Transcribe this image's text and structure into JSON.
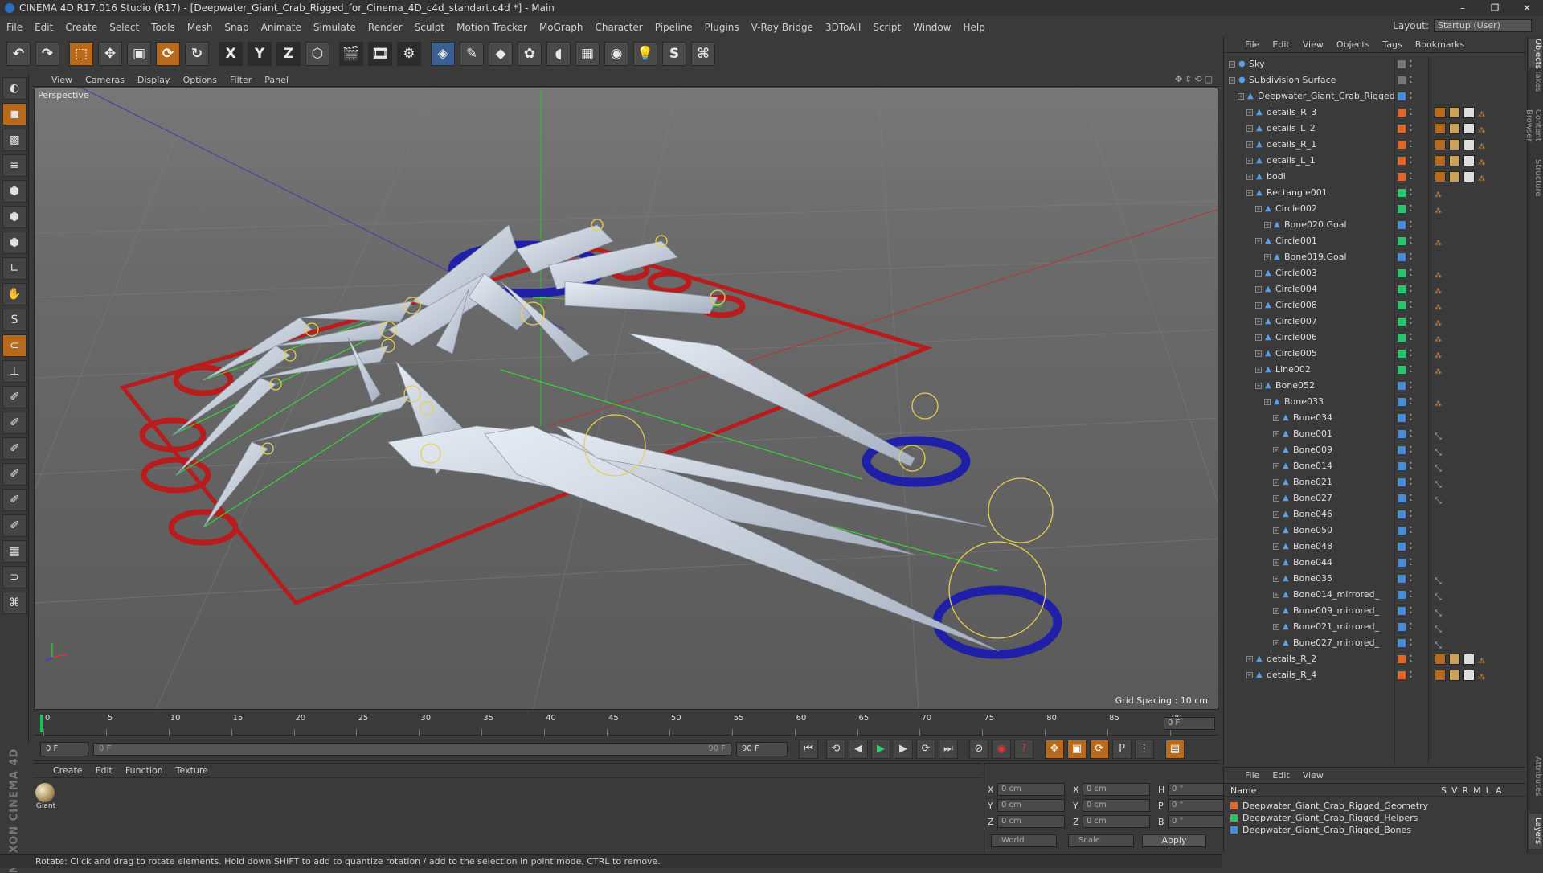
{
  "window": {
    "title": "CINEMA 4D R17.016 Studio (R17) - [Deepwater_Giant_Crab_Rigged_for_Cinema_4D_c4d_standart.c4d *] - Main",
    "controls": [
      "–",
      "❐",
      "✕"
    ]
  },
  "menubar": [
    "File",
    "Edit",
    "Create",
    "Select",
    "Tools",
    "Mesh",
    "Snap",
    "Animate",
    "Simulate",
    "Render",
    "Sculpt",
    "Motion Tracker",
    "MoGraph",
    "Character",
    "Pipeline",
    "Plugins",
    "V-Ray Bridge",
    "3DToAll",
    "Script",
    "Window",
    "Help"
  ],
  "layout": {
    "label": "Layout:",
    "value": "Startup (User)"
  },
  "toolbar": {
    "x": "X",
    "y": "Y",
    "z": "Z"
  },
  "viewport": {
    "menu": [
      "View",
      "Cameras",
      "Display",
      "Options",
      "Filter",
      "Panel"
    ],
    "label": "Perspective",
    "grid_spacing": "Grid Spacing : 10 cm"
  },
  "timeline": {
    "ticks": [
      "0",
      "5",
      "10",
      "15",
      "20",
      "25",
      "30",
      "35",
      "40",
      "45",
      "50",
      "55",
      "60",
      "65",
      "70",
      "75",
      "80",
      "85",
      "90"
    ],
    "current_frame_field": "0 F"
  },
  "transport": {
    "start": "0 F",
    "slider_start": "0 F",
    "slider_end": "90 F",
    "end": "90 F"
  },
  "materials": {
    "menu": [
      "Create",
      "Edit",
      "Function",
      "Texture"
    ],
    "items": [
      {
        "name": "Giant"
      }
    ]
  },
  "coords": {
    "rows": [
      {
        "a": "X",
        "av": "0 cm",
        "b": "X",
        "bv": "0 cm",
        "c": "H",
        "cv": "0 °"
      },
      {
        "a": "Y",
        "av": "0 cm",
        "b": "Y",
        "bv": "0 cm",
        "c": "P",
        "cv": "0 °"
      },
      {
        "a": "Z",
        "av": "0 cm",
        "b": "Z",
        "bv": "0 cm",
        "c": "B",
        "cv": "0 °"
      }
    ],
    "mode": "World",
    "type": "Scale",
    "apply": "Apply"
  },
  "status": "Rotate: Click and drag to rotate elements. Hold down SHIFT to add to quantize rotation / add to the selection in point mode, CTRL to remove.",
  "objects": {
    "menu": [
      "File",
      "Edit",
      "View",
      "Objects",
      "Tags",
      "Bookmarks"
    ],
    "rows": [
      {
        "name": "Sky",
        "color": "#777777"
      },
      {
        "name": "Subdivision Surface",
        "color": "#777777"
      },
      {
        "name": "Deepwater_Giant_Crab_Rigged",
        "color": "#4a8bd6"
      },
      {
        "name": "details_R_3",
        "color": "#e0662a"
      },
      {
        "name": "details_L_2",
        "color": "#e0662a"
      },
      {
        "name": "details_R_1",
        "color": "#e0662a"
      },
      {
        "name": "details_L_1",
        "color": "#e0662a"
      },
      {
        "name": "bodi",
        "color": "#e0662a"
      },
      {
        "name": "Rectangle001",
        "color": "#25c46d"
      },
      {
        "name": "Circle002",
        "color": "#25c46d"
      },
      {
        "name": "Bone020.Goal",
        "color": "#4a8bd6"
      },
      {
        "name": "Circle001",
        "color": "#25c46d"
      },
      {
        "name": "Bone019.Goal",
        "color": "#4a8bd6"
      },
      {
        "name": "Circle003",
        "color": "#25c46d"
      },
      {
        "name": "Circle004",
        "color": "#25c46d"
      },
      {
        "name": "Circle008",
        "color": "#25c46d"
      },
      {
        "name": "Circle007",
        "color": "#25c46d"
      },
      {
        "name": "Circle006",
        "color": "#25c46d"
      },
      {
        "name": "Circle005",
        "color": "#25c46d"
      },
      {
        "name": "Line002",
        "color": "#25c46d"
      },
      {
        "name": "Bone052",
        "color": "#4a8bd6"
      },
      {
        "name": "Bone033",
        "color": "#4a8bd6"
      },
      {
        "name": "Bone034",
        "color": "#4a8bd6"
      },
      {
        "name": "Bone001",
        "color": "#4a8bd6"
      },
      {
        "name": "Bone009",
        "color": "#4a8bd6"
      },
      {
        "name": "Bone014",
        "color": "#4a8bd6"
      },
      {
        "name": "Bone021",
        "color": "#4a8bd6"
      },
      {
        "name": "Bone027",
        "color": "#4a8bd6"
      },
      {
        "name": "Bone046",
        "color": "#4a8bd6"
      },
      {
        "name": "Bone050",
        "color": "#4a8bd6"
      },
      {
        "name": "Bone048",
        "color": "#4a8bd6"
      },
      {
        "name": "Bone044",
        "color": "#4a8bd6"
      },
      {
        "name": "Bone035",
        "color": "#4a8bd6"
      },
      {
        "name": "Bone014_mirrored_",
        "color": "#4a8bd6"
      },
      {
        "name": "Bone009_mirrored_",
        "color": "#4a8bd6"
      },
      {
        "name": "Bone021_mirrored_",
        "color": "#4a8bd6"
      },
      {
        "name": "Bone027_mirrored_",
        "color": "#4a8bd6"
      },
      {
        "name": "details_R_2",
        "color": "#e0662a"
      },
      {
        "name": "details_R_4",
        "color": "#e0662a"
      }
    ]
  },
  "layers": {
    "menu": [
      "File",
      "Edit",
      "View"
    ],
    "header": {
      "name": "Name",
      "cols": [
        "S",
        "V",
        "R",
        "M",
        "L",
        "A"
      ]
    },
    "rows": [
      {
        "name": "Deepwater_Giant_Crab_Rigged_Geometry",
        "color": "#e0662a"
      },
      {
        "name": "Deepwater_Giant_Crab_Rigged_Helpers",
        "color": "#25c46d"
      },
      {
        "name": "Deepwater_Giant_Crab_Rigged_Bones",
        "color": "#4a8bd6"
      }
    ]
  },
  "right_tabs": [
    "Objects",
    "Takes",
    "Content Browser",
    "Structure",
    "Attributes",
    "Layers"
  ]
}
